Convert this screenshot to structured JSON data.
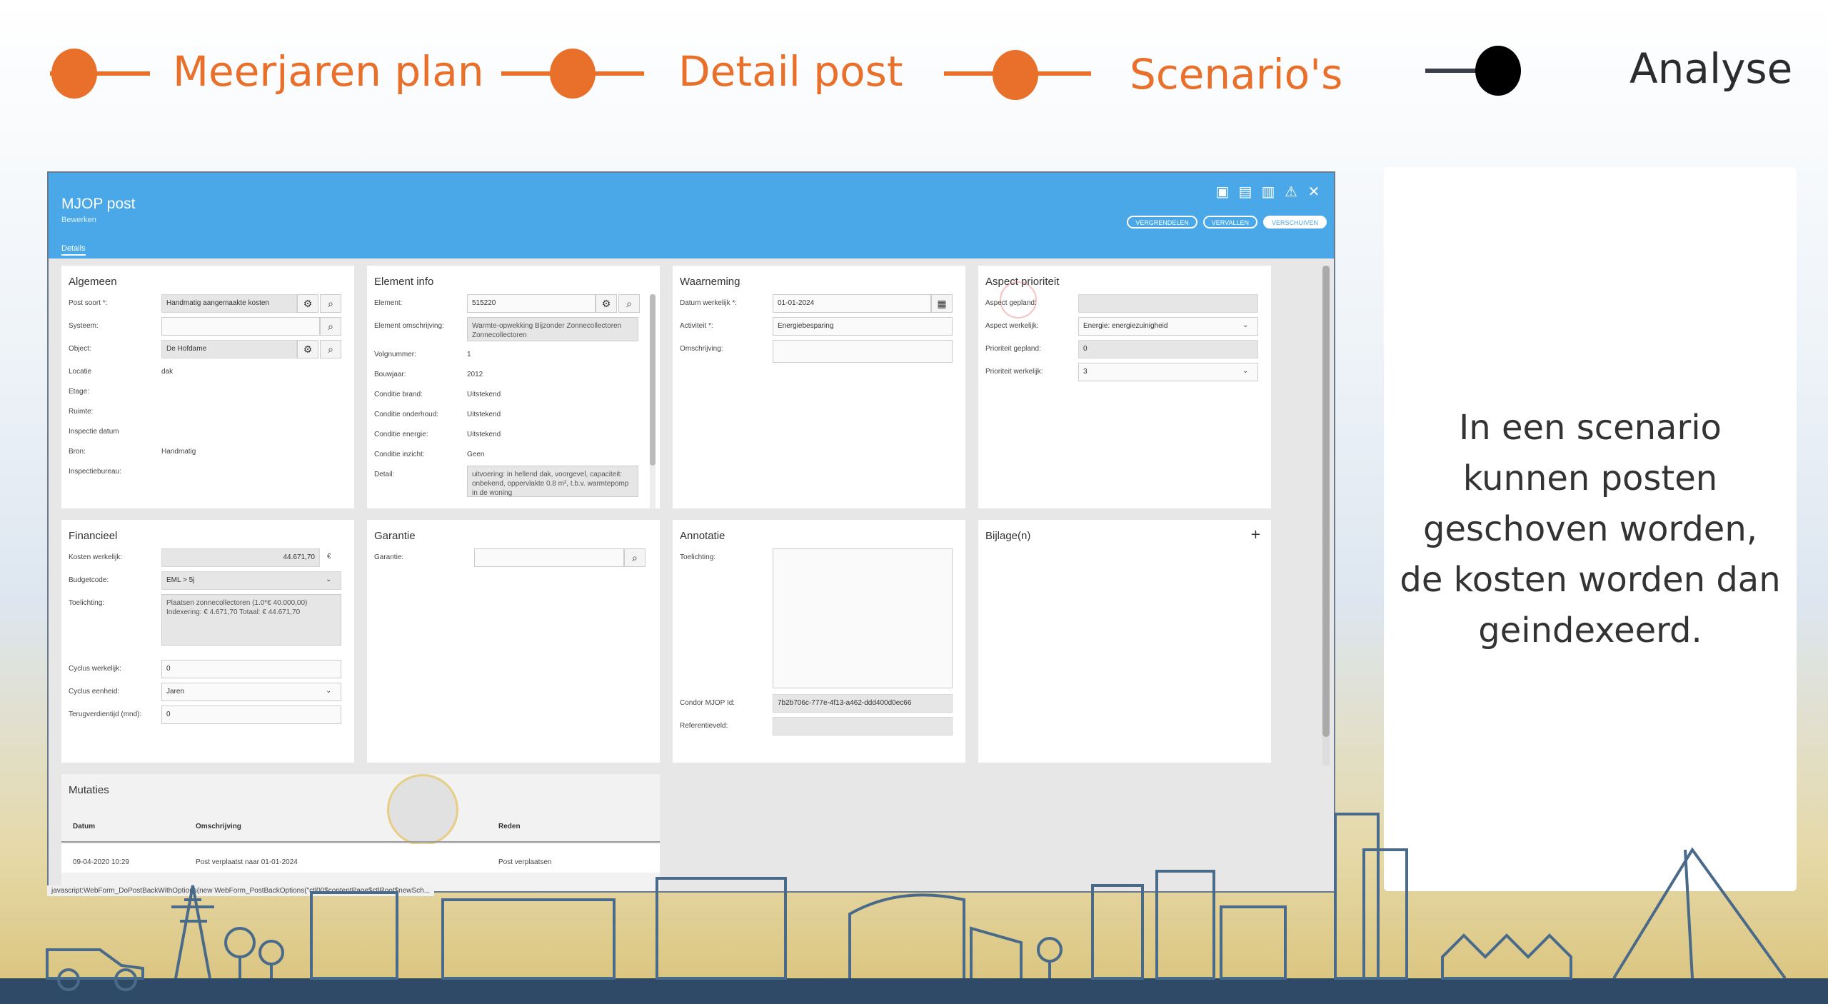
{
  "steps": [
    {
      "label": "Meerjaren plan",
      "state": "done",
      "color": "#e8702a"
    },
    {
      "label": "Detail post",
      "state": "done",
      "color": "#e8702a"
    },
    {
      "label": "Scenario's",
      "state": "done",
      "color": "#e8702a"
    },
    {
      "label": "Analyse",
      "state": "current",
      "color": "#000000"
    }
  ],
  "app": {
    "title": "MJOP post",
    "subtitle": "Bewerken",
    "tab": "Details",
    "header_buttons": [
      "VERGRENDELEN",
      "VERVALLEN",
      "VERSCHUIVEN"
    ],
    "window_icons": [
      "save-icon",
      "save-as-icon",
      "delete-icon",
      "warning-icon",
      "close-icon"
    ]
  },
  "algemeen": {
    "title": "Algemeen",
    "post_soort_label": "Post soort *:",
    "post_soort_value": "Handmatig aangemaakte kosten",
    "systeem_label": "Systeem:",
    "object_label": "Object:",
    "object_value": "De Hofdame",
    "locatie_label": "Locatie",
    "locatie_value": "dak",
    "etage_label": "Etage:",
    "ruimte_label": "Ruimte:",
    "inspectie_label": "Inspectie datum",
    "bron_label": "Bron:",
    "bron_value": "Handmatig",
    "bureau_label": "Inspectiebureau:"
  },
  "element": {
    "title": "Element info",
    "element_label": "Element:",
    "element_value": "515220",
    "omschrijving_label": "Element omschrijving:",
    "omschrijving_value": "Warmte-opwekking Bijzonder Zonnecollectoren Zonnecollectoren",
    "volgnummer_label": "Volgnummer:",
    "volgnummer_value": "1",
    "bouwjaar_label": "Bouwjaar:",
    "bouwjaar_value": "2012",
    "conditie_brand_label": "Conditie brand:",
    "conditie_brand_value": "Uitstekend",
    "conditie_onderhoud_label": "Conditie onderhoud:",
    "conditie_onderhoud_value": "Uitstekend",
    "conditie_energie_label": "Conditie energie:",
    "conditie_energie_value": "Uitstekend",
    "conditie_inzicht_label": "Conditie inzicht:",
    "conditie_inzicht_value": "Geen",
    "detail_label": "Detail:",
    "detail_value": "uitvoering: in hellend dak, voorgevel, capaciteit: onbekend, oppervlakte 0.8 m², t.b.v. warmtepomp in de woning"
  },
  "waarneming": {
    "title": "Waarneming",
    "datum_label": "Datum werkelijk *:",
    "datum_value": "01-01-2024",
    "activiteit_label": "Activiteit *:",
    "activiteit_value": "Energiebesparing",
    "omschrijving_label": "Omschrijving:"
  },
  "aspect": {
    "title": "Aspect prioriteit",
    "gepland_label": "Aspect gepland:",
    "werkelijk_label": "Aspect werkelijk:",
    "werkelijk_value": "Energie: energiezuinigheid",
    "prio_gepland_label": "Prioriteit gepland:",
    "prio_gepland_value": "0",
    "prio_werkelijk_label": "Prioriteit werkelijk:",
    "prio_werkelijk_value": "3"
  },
  "financieel": {
    "title": "Financieel",
    "kosten_label": "Kosten werkelijk:",
    "kosten_value": "44.671,70",
    "currency": "€",
    "budget_label": "Budgetcode:",
    "budget_value": "EML > 5j",
    "toelichting_label": "Toelichting:",
    "toelichting_value": "Plaatsen zonnecollectoren (1.0*€ 40.000,00) Indexering: € 4.671,70 Totaal: € 44.671,70",
    "cyclus_label": "Cyclus werkelijk:",
    "cyclus_value": "0",
    "eenheid_label": "Cyclus eenheid:",
    "eenheid_value": "Jaren",
    "terug_label": "Terugverdientijd (mnd):",
    "terug_value": "0"
  },
  "garantie": {
    "title": "Garantie",
    "garantie_label": "Garantie:"
  },
  "annotatie": {
    "title": "Annotatie",
    "toelichting_label": "Toelichting:",
    "condor_label": "Condor MJOP Id:",
    "condor_value": "7b2b706c-777e-4f13-a462-ddd400d0ec66",
    "referentie_label": "Referentieveld:"
  },
  "bijlagen": {
    "title": "Bijlage(n)",
    "add": "+"
  },
  "mutaties": {
    "title": "Mutaties",
    "columns": [
      "Datum",
      "Omschrijving",
      "Reden"
    ],
    "rows": [
      {
        "datum": "09-04-2020 10:29",
        "omschrijving": "Post verplaatst naar 01-01-2024",
        "reden": "Post verplaatsen"
      }
    ]
  },
  "statusbar": "javascript:WebForm_DoPostBackWithOptions(new WebForm_PostBackOptions(\"ctl00$contentPage$ctlRoot$newSch...",
  "info_text": "In een scenario kunnen posten geschoven worden, de kosten worden dan geindexeerd."
}
